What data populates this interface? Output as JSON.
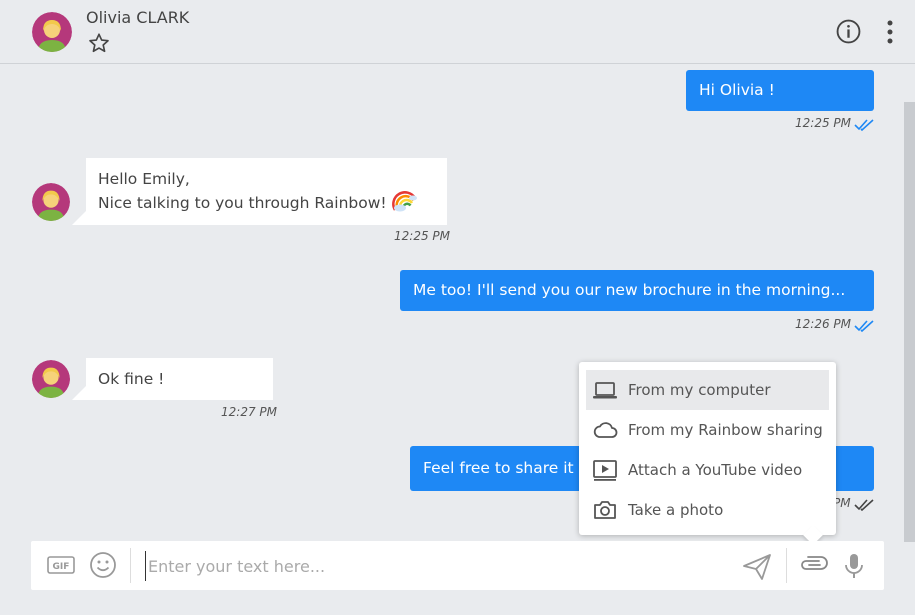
{
  "header": {
    "contact_name": "Olivia CLARK"
  },
  "messages": [
    {
      "direction": "out",
      "text": "Hi Olivia !",
      "time": "12:25 PM"
    },
    {
      "direction": "in",
      "line1": "Hello Emily,",
      "line2": "Nice talking to you through Rainbow!",
      "emoji": "rainbow-emoji",
      "time": "12:25 PM"
    },
    {
      "direction": "out",
      "text": "Me too! I'll send you our new brochure in the morning...",
      "time": "12:26 PM"
    },
    {
      "direction": "in",
      "text": "Ok fine !",
      "time": "12:27 PM"
    },
    {
      "direction": "out",
      "text": "Feel free to share it w",
      "time": "PM"
    }
  ],
  "attach_menu": {
    "items": [
      {
        "label": "From my computer",
        "icon": "laptop-icon",
        "active": true
      },
      {
        "label": "From my Rainbow sharing",
        "icon": "cloud-icon"
      },
      {
        "label": "Attach a YouTube video",
        "icon": "video-icon"
      },
      {
        "label": "Take a photo",
        "icon": "camera-icon"
      }
    ]
  },
  "composer": {
    "placeholder": "Enter your text here..."
  },
  "colors": {
    "outgoing_bubble": "#1e88f5",
    "incoming_bubble": "#ffffff",
    "background": "#e9ebee",
    "read_check": "#1e88f5"
  }
}
